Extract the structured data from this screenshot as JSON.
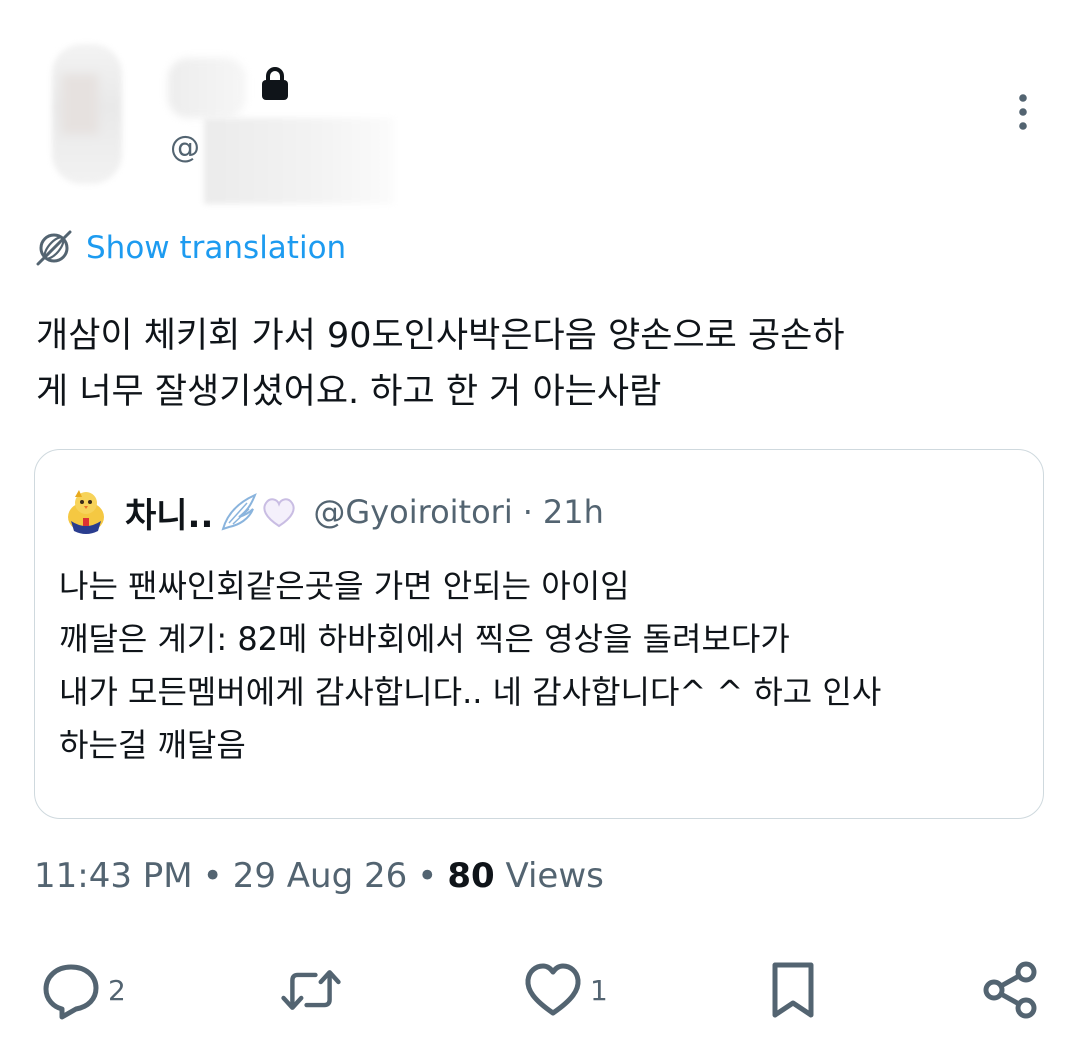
{
  "author": {
    "handle_prefix": "@",
    "protected_icon": "lock-icon"
  },
  "menu": {
    "icon": "more-vertical-icon"
  },
  "translation": {
    "label": "Show translation",
    "icon": "translate-globe-icon"
  },
  "tweet": {
    "text_lines": [
      "개삼이 체키회 가서 90도인사박은다음 양손으로 공손하",
      "게 너무 잘생기셨어요. 하고 한 거 아는사람"
    ]
  },
  "quote": {
    "display_name": "차니..",
    "name_emojis": [
      "wing-emoji",
      "white-heart-emoji"
    ],
    "handle": "@Gyoiroitori",
    "separator": "·",
    "time": "21h",
    "avatar_icon": "bird-avatar-icon",
    "body_lines": [
      "나는 팬싸인회같은곳을 가면 안되는 아이임",
      "깨달은 계기: 82메 하바회에서 찍은 영상을 돌려보다가",
      "내가 모든멤버에게 감사합니다.. 네 감사합니다^ ^ 하고 인사",
      "하는걸 깨달음"
    ]
  },
  "meta": {
    "time": "11:43 PM",
    "date": "29 Aug 26",
    "separator": "•",
    "views_count": "80",
    "views_label": "Views"
  },
  "actions": {
    "reply_count": "2",
    "like_count": "1",
    "icons": [
      "reply-icon",
      "retweet-icon",
      "like-icon",
      "bookmark-icon",
      "share-icon"
    ]
  },
  "colors": {
    "accent": "#1d9bf0",
    "text_primary": "#0f1419",
    "text_secondary": "#536471",
    "border": "#cfd9de"
  }
}
